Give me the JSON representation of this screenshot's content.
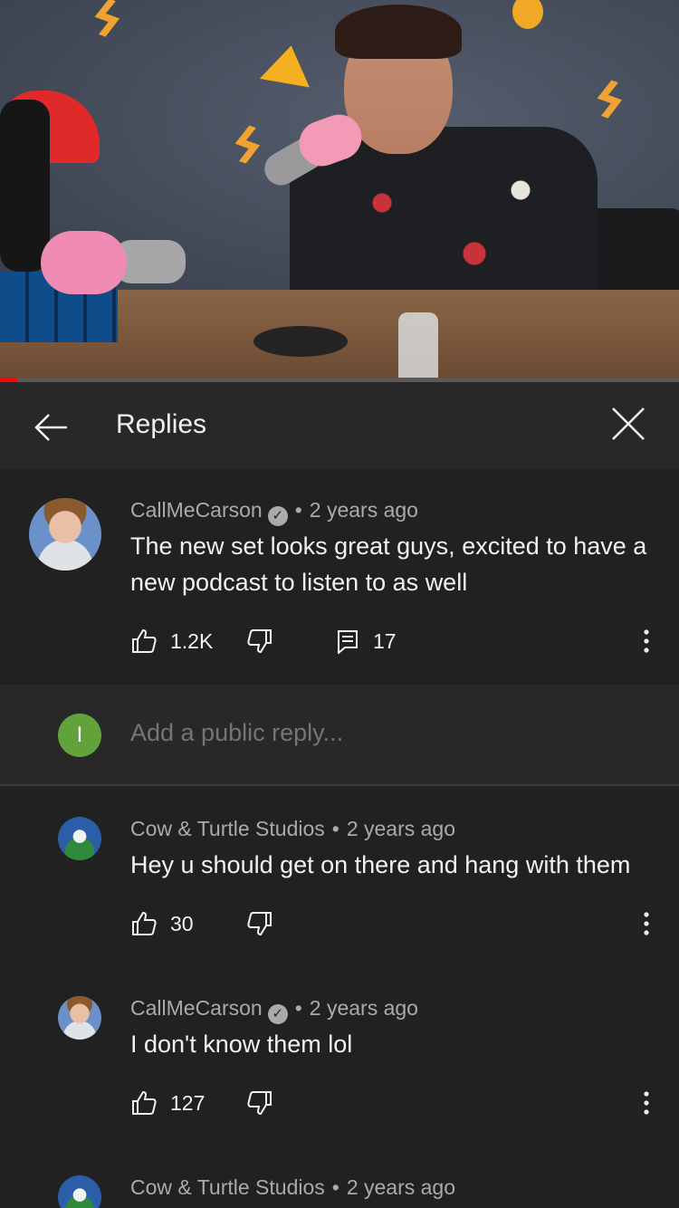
{
  "video": {
    "progress_fraction": 0.025,
    "progress_color": "#ff0000"
  },
  "header": {
    "title": "Replies",
    "back_icon": "arrow-left-icon",
    "close_icon": "close-icon"
  },
  "top_comment": {
    "author": "CallMeCarson",
    "verified": true,
    "time": "2 years ago",
    "text": "The new set looks great guys, excited to have a new podcast to listen to as well",
    "likes": "1.2K",
    "replies": "17"
  },
  "reply_box": {
    "avatar_letter": "I",
    "avatar_color": "#61a33a",
    "placeholder": "Add a public reply..."
  },
  "replies": [
    {
      "author": "Cow & Turtle Studios",
      "verified": false,
      "time": "2 years ago",
      "text": "Hey u should get on there and hang with them",
      "likes": "30"
    },
    {
      "author": "CallMeCarson",
      "verified": true,
      "time": "2 years ago",
      "text": "I don't know them lol",
      "likes": "127"
    },
    {
      "author": "Cow & Turtle Studios",
      "verified": false,
      "time": "2 years ago",
      "text": "",
      "likes": ""
    }
  ],
  "separator": "•"
}
